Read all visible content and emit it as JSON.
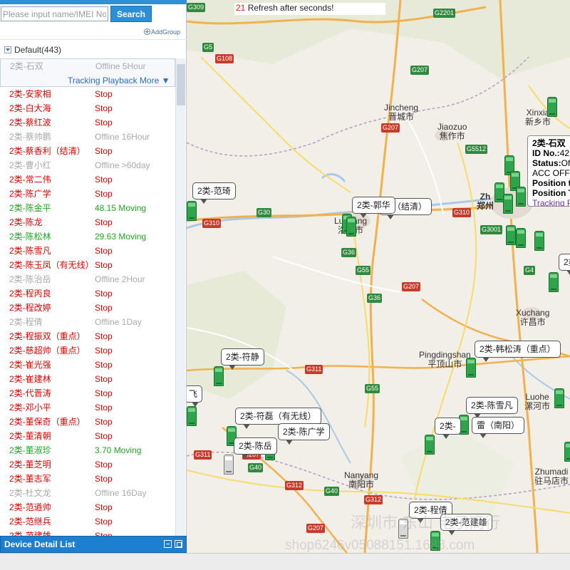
{
  "search": {
    "placeholder": "Please input name/IMEI No.",
    "button": "Search"
  },
  "add_group": "AddGroup",
  "group": {
    "label": "Default(443)"
  },
  "selected_device": {
    "name": "2类-石双",
    "status": "Offline 5Hour",
    "links": "Tracking Playback More ▼"
  },
  "devices": [
    {
      "name": "2类-安家相",
      "status": "Stop",
      "state": "stop"
    },
    {
      "name": "2类-白大海",
      "status": "Stop",
      "state": "stop"
    },
    {
      "name": "2类-蔡红波",
      "status": "Stop",
      "state": "stop"
    },
    {
      "name": "2类-蔡帅鹏",
      "status": "Offline 16Hour",
      "state": "offline"
    },
    {
      "name": "2类-蔡香利（结清）",
      "status": "Stop",
      "state": "stop"
    },
    {
      "name": "2类-曹小红",
      "status": "Offline >60day",
      "state": "offline"
    },
    {
      "name": "2类-常二伟",
      "status": "Stop",
      "state": "stop"
    },
    {
      "name": "2类-陈广学",
      "status": "Stop",
      "state": "stop"
    },
    {
      "name": "2类-陈金平",
      "status": "48.15  Moving",
      "state": "moving"
    },
    {
      "name": "2类-陈龙",
      "status": "Stop",
      "state": "stop"
    },
    {
      "name": "2类-陈松林",
      "status": "29.63  Moving",
      "state": "moving"
    },
    {
      "name": "2类-陈雪凡",
      "status": "Stop",
      "state": "stop"
    },
    {
      "name": "2类-陈玉凤（有无线）",
      "status": "Stop",
      "state": "stop"
    },
    {
      "name": "2类-陈治岳",
      "status": "Offline 2Hour",
      "state": "offline"
    },
    {
      "name": "2类-程丙良",
      "status": "Stop",
      "state": "stop"
    },
    {
      "name": "2类-程改婷",
      "status": "Stop",
      "state": "stop"
    },
    {
      "name": "2类-程倩",
      "status": "Offline 1Day",
      "state": "offline"
    },
    {
      "name": "2类-程振双（重点）",
      "status": "Stop",
      "state": "stop"
    },
    {
      "name": "2类-慈超帅（重点）",
      "status": "Stop",
      "state": "stop"
    },
    {
      "name": "2类-崔光强",
      "status": "Stop",
      "state": "stop"
    },
    {
      "name": "2类-崔建林",
      "status": "Stop",
      "state": "stop"
    },
    {
      "name": "2类-代晋涛",
      "status": "Stop",
      "state": "stop"
    },
    {
      "name": "2类-邓小平",
      "status": "Stop",
      "state": "stop"
    },
    {
      "name": "2类-董保奇（重点）",
      "status": "Stop",
      "state": "stop"
    },
    {
      "name": "2类-董清朝",
      "status": "Stop",
      "state": "stop"
    },
    {
      "name": "2类-董淑珍",
      "status": "3.70  Moving",
      "state": "moving"
    },
    {
      "name": "2类-董芝明",
      "status": "Stop",
      "state": "stop"
    },
    {
      "name": "2类-董志军",
      "status": "Stop",
      "state": "stop"
    },
    {
      "name": "2类-杜文龙",
      "status": "Offline 16Day",
      "state": "offline"
    },
    {
      "name": "2类-范遒帅",
      "status": "Stop",
      "state": "stop"
    },
    {
      "name": "2类-范继兵",
      "status": "Stop",
      "state": "stop"
    },
    {
      "name": "2类-范建雄",
      "status": "Stop",
      "state": "stop"
    }
  ],
  "detail_list": {
    "title": "Device Detail List"
  },
  "refresh": {
    "count": "21",
    "text": " Refresh after seconds!"
  },
  "map": {
    "cities": [
      {
        "cn": "",
        "en": "Jincheng",
        "cn2": "晋城市"
      },
      {
        "cn": "",
        "en": "Jiaozuo",
        "cn2": "焦作市"
      },
      {
        "cn": "",
        "en": "Xinxia",
        "cn2": "新乡市"
      },
      {
        "cn": "",
        "en": "Xuchang",
        "cn2": "许昌市"
      },
      {
        "cn": "",
        "en": "Pingdingshan",
        "cn2": "平顶山市"
      },
      {
        "cn": "",
        "en": "Luohe",
        "cn2": "漯河市"
      },
      {
        "cn": "",
        "en": "Nanyang",
        "cn2": "南阳市"
      },
      {
        "cn": "",
        "en": "Zhumadi",
        "cn2": "驻马店市"
      },
      {
        "cn": "",
        "en": "Luoyang",
        "cn2": "洛阳市"
      },
      {
        "cn": "",
        "en": "Zh",
        "cn2": "郑州"
      }
    ],
    "roads": [
      "G309",
      "G2201",
      "G5",
      "G108",
      "G207",
      "G207",
      "G5512",
      "G310",
      "G30",
      "G310",
      "G36",
      "G3001",
      "G55",
      "G36",
      "G207",
      "G4",
      "G311",
      "G55",
      "G311",
      "G207",
      "G40",
      "G312",
      "G40",
      "G312",
      "G207"
    ],
    "bubbles": [
      "2类-范琦",
      "2类-郭华",
      "利（结清）",
      "2类-符静",
      "2类-韩松涛（重点）",
      "2类-符磊（有无线）",
      "2类-陈广学",
      "2类-陈岳",
      "2类-陈雪凡",
      "2类-",
      "雷（南阳）",
      "2类-程倩",
      "2类-范建雄",
      "飞",
      "2类-"
    ]
  },
  "popup": {
    "title": "2类-石双",
    "id_label": "ID No.:",
    "id_value": "42",
    "status_label": "Status:",
    "status_value": "Of",
    "acc": "ACC OFF",
    "pos1_label": "Position t",
    "pos2_label": "Position T",
    "link1": "Tracking",
    "link2": "P"
  },
  "watermark": {
    "line1": "深圳市 东山 电子商行",
    "line2": "shop6246v05088151.1688.com"
  }
}
